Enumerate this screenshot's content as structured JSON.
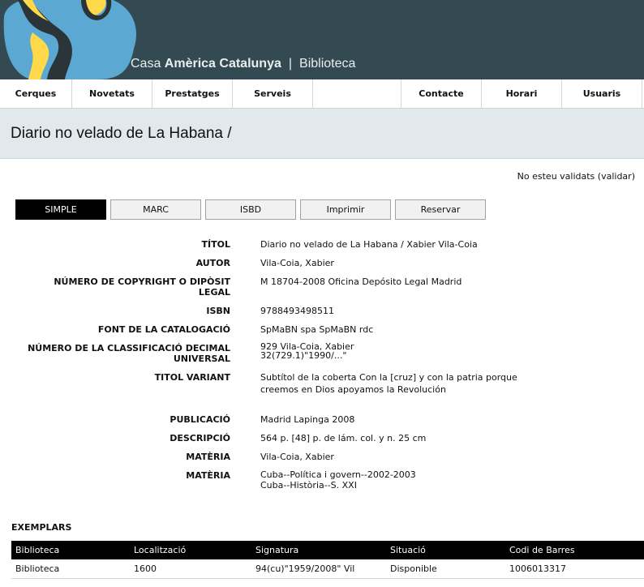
{
  "header": {
    "title_light": "Casa ",
    "title_bold": "Amèrica Catalunya",
    "separator": "|",
    "section": "Biblioteca",
    "logo_icon": "globe-logo-icon",
    "colors": {
      "background": "#344a52",
      "logo_blue": "#5ba9d3",
      "logo_yellow": "#ffd94a"
    }
  },
  "nav": {
    "items": [
      {
        "label": "Cerques"
      },
      {
        "label": "Novetats"
      },
      {
        "label": "Prestatges"
      },
      {
        "label": "Serveis"
      },
      {
        "label": ""
      },
      {
        "label": "Contacte"
      },
      {
        "label": "Horari"
      },
      {
        "label": "Usuaris"
      }
    ]
  },
  "page": {
    "title": "Diario no velado de La Habana /",
    "login_text": "No esteu validats",
    "login_link": "(validar)"
  },
  "tabs": [
    {
      "label": "SIMPLE",
      "active": true
    },
    {
      "label": "MARC",
      "active": false
    },
    {
      "label": "ISBD",
      "active": false
    },
    {
      "label": "Imprimir",
      "active": false
    },
    {
      "label": "Reservar",
      "active": false
    }
  ],
  "record": [
    {
      "label": "TÍTOL",
      "value": "Diario no velado de La Habana / Xabier Vila-Coia"
    },
    {
      "label": "AUTOR",
      "value": "Vila-Coia, Xabier"
    },
    {
      "label_line1": "NÚMERO DE COPYRIGHT O DIPÒSIT",
      "label_line2": "LEGAL",
      "value": "M 18704-2008 Oficina Depósito Legal Madrid"
    },
    {
      "label": "ISBN",
      "value": "9788493498511"
    },
    {
      "label": "FONT DE LA CATALOGACIÓ",
      "value": "SpMaBN spa SpMaBN rdc"
    },
    {
      "label_line1": "NÚMERO DE LA CLASSIFICACIÓ DECIMAL",
      "label_line2": "UNIVERSAL",
      "value_line1": "929 Vila-Coia, Xabier",
      "value_line2": "32(729.1)\"1990/...\""
    },
    {
      "label": "TITOL VARIANT",
      "value_line1": "Subtítol de la coberta Con la [cruz] y con la patria porque",
      "value_line2": "creemos en Dios apoyamos la Revolución"
    },
    {
      "label": "PUBLICACIÓ",
      "value": "Madrid Lapinga 2008"
    },
    {
      "label": "DESCRIPCIÓ",
      "value": "564 p. [48] p. de lám. col. y n. 25 cm"
    },
    {
      "label": "MATÈRIA",
      "value": "Vila-Coia, Xabier"
    },
    {
      "label": "MATÈRIA",
      "value_line1": "Cuba--Política i govern--2002-2003",
      "value_line2": "Cuba--Història--S. XXI"
    }
  ],
  "exemplars": {
    "heading": "EXEMPLARS",
    "columns": [
      "Biblioteca",
      "Localització",
      "Signatura",
      "Situació",
      "Codi de Barres"
    ],
    "rows": [
      [
        "Biblioteca",
        "1600",
        "94(cu)\"1959/2008\" Vil",
        "Disponible",
        "1006013317"
      ]
    ]
  }
}
